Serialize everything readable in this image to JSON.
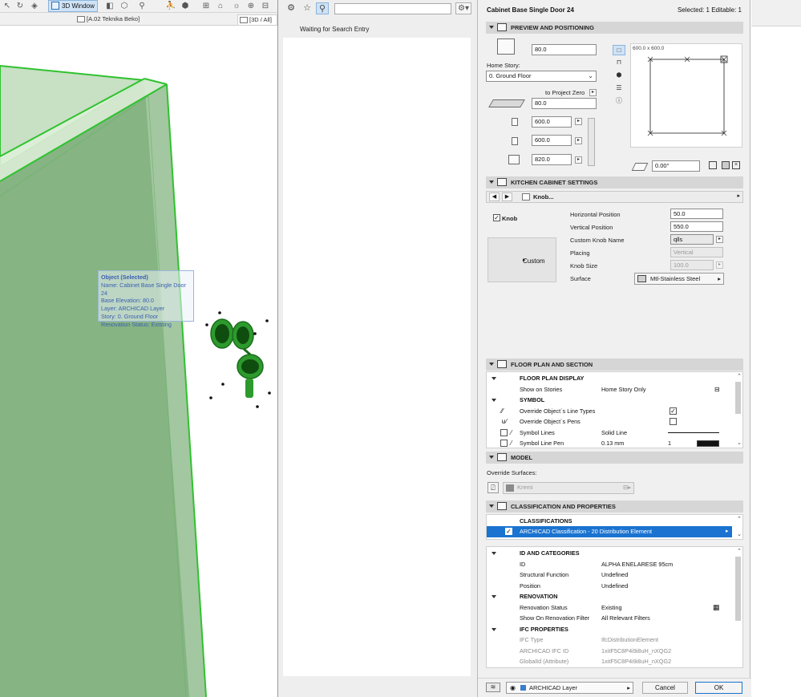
{
  "colors": {
    "accent": "#1a73d0",
    "object_green": "#7fb27f",
    "edge_green": "#2fc22f",
    "tooltip_text": "#3a5fb0"
  },
  "view3d": {
    "toolbar": {
      "window_button": "3D Window"
    },
    "tabs": [
      {
        "label": "[A.02 Teknika Beko]"
      },
      {
        "label": "[3D / All]"
      }
    ],
    "tooltip": {
      "title": "Object (Selected)",
      "lines": [
        "Name: Cabinet Base Single Door 24",
        "Base Elevation: 80.0",
        "Layer: ARCHICAD Layer",
        "Story: 0. Ground Floor",
        "Renovation Status: Existing"
      ]
    }
  },
  "search_panel": {
    "search_value": "",
    "status": "Waiting for Search Entry"
  },
  "dialog": {
    "title": "Cabinet Base Single Door 24",
    "selection": "Selected: 1 Editable: 1",
    "preview_positioning": {
      "header": "PREVIEW AND POSITIONING",
      "elevation": "80.0",
      "home_story_label": "Home Story:",
      "home_story_value": "0. Ground Floor",
      "to_project_zero_label": "to Project Zero",
      "project_zero_value": "80.0",
      "width": "600.0",
      "depth": "600.0",
      "height": "820.0",
      "preview_dims": "600.0 x 600.0",
      "rotation": "0.00°"
    },
    "kitchen": {
      "header": "KITCHEN CABINET SETTINGS",
      "page": "Knob...",
      "knob_label": "Knob",
      "knob_checked": true,
      "custom_label": "Custom",
      "fields": [
        {
          "label": "Horizontal Position",
          "value": "50.0"
        },
        {
          "label": "Vertical Position",
          "value": "550.0"
        },
        {
          "label": "Custom Knob Name",
          "value": "qlls"
        },
        {
          "label": "Placing",
          "value": "Vertical"
        },
        {
          "label": "Knob Size",
          "value": "100.0"
        },
        {
          "label": "Surface",
          "value": "Mtl-Stainless Steel"
        }
      ]
    },
    "floor_plan": {
      "header": "FLOOR PLAN AND SECTION",
      "group_display": "FLOOR PLAN DISPLAY",
      "show_on_stories_label": "Show on Stories",
      "show_on_stories_value": "Home Story Only",
      "group_symbol": "SYMBOL",
      "override_line_types": "Override Object´s Line Types",
      "override_pens": "Override Object´s Pens",
      "symbol_lines_label": "Symbol Lines",
      "symbol_lines_value": "Solid Line",
      "symbol_pen_label": "Symbol Line Pen",
      "symbol_pen_value": "0.13 mm",
      "symbol_pen_number": "1"
    },
    "model": {
      "header": "MODEL",
      "override_surfaces_label": "Override Surfaces:",
      "surface_value": "Kremi"
    },
    "classification": {
      "header": "CLASSIFICATION AND PROPERTIES",
      "group_classifications": "CLASSIFICATIONS",
      "selected_row": "ARCHICAD Classification - 20 Distribution Element",
      "rows": [
        {
          "label": "ID AND CATEGORIES",
          "value": "",
          "type": "group"
        },
        {
          "label": "ID",
          "value": "ALPHA ENELARESE 95cm",
          "type": "row"
        },
        {
          "label": "Structural Function",
          "value": "Undefined",
          "type": "row"
        },
        {
          "label": "Position",
          "value": "Undefined",
          "type": "row"
        },
        {
          "label": "RENOVATION",
          "value": "",
          "type": "group"
        },
        {
          "label": "Renovation Status",
          "value": "Existing",
          "type": "row"
        },
        {
          "label": "Show On Renovation Filter",
          "value": "All Relevant Filters",
          "type": "row"
        },
        {
          "label": "IFC PROPERTIES",
          "value": "",
          "type": "group"
        },
        {
          "label": "IFC Type",
          "value": "IfcDistributionElement",
          "type": "gray"
        },
        {
          "label": "ARCHICAD IFC ID",
          "value": "1xitF5C8P4i9i8uH_nXQG2",
          "type": "gray"
        },
        {
          "label": "GlobalId (Attribute)",
          "value": "1xitF5C8P4i9i8uH_nXQG2",
          "type": "gray"
        }
      ]
    },
    "footer": {
      "layer": "ARCHICAD Layer",
      "cancel": "Cancel",
      "ok": "OK"
    }
  }
}
